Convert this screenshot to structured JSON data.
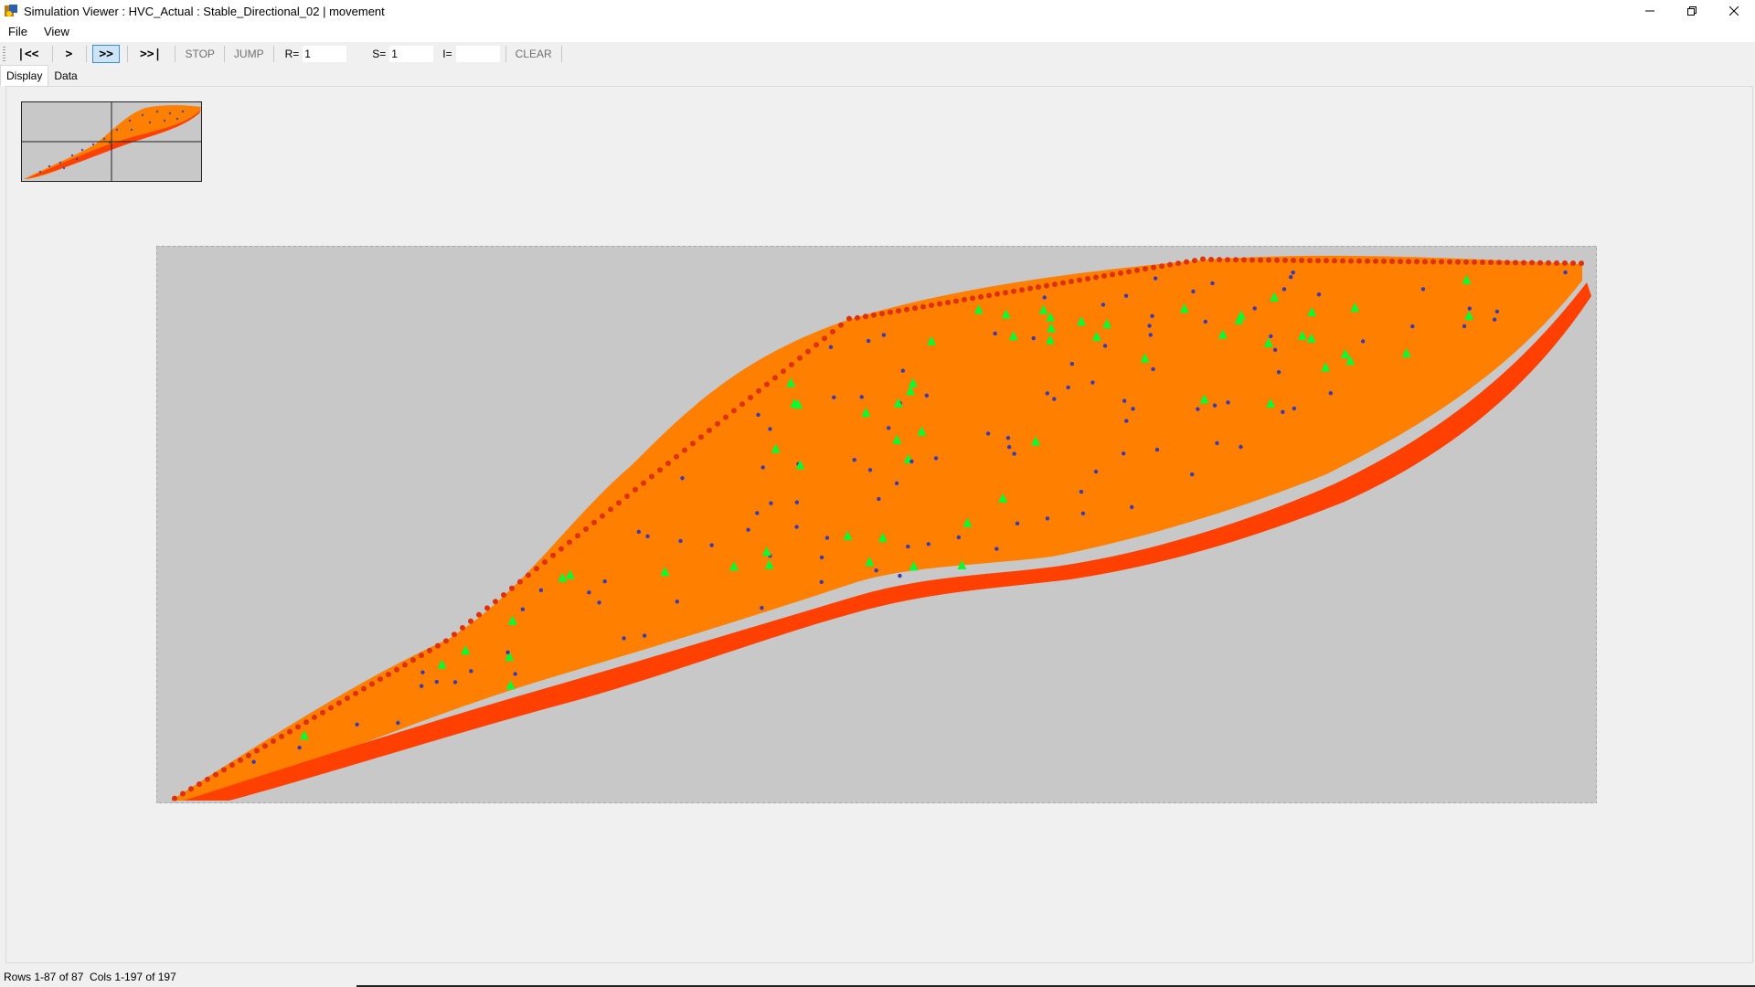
{
  "window": {
    "title": "Simulation Viewer : HVC_Actual : Stable_Directional_02 | movement",
    "controls": {
      "minimize": "–",
      "restore": "❐",
      "close": "✕"
    }
  },
  "menu": {
    "items": [
      "File",
      "View"
    ]
  },
  "toolbar": {
    "first_label": "|<<",
    "step_label": ">",
    "play_label": ">>",
    "last_label": ">>|",
    "stop_label": "STOP",
    "jump_label": "JUMP",
    "r_label": "R=",
    "r_value": "1",
    "s_label": "S=",
    "s_value": "1",
    "i_label": "I=",
    "i_value": "",
    "clear_label": "CLEAR"
  },
  "tabs": [
    {
      "label": "Display",
      "active": true
    },
    {
      "label": "Data",
      "active": false
    }
  ],
  "status": {
    "text": "Rows 1-87 of 87  Cols 1-197 of 197"
  },
  "colors": {
    "background_grid": "#c8c8c8",
    "cell_fill": "#ff7f00",
    "edge_fill": "#ff4000",
    "boundary_dot": "#e0300a",
    "agent_green": "#00ff33",
    "agent_blue": "#3a3ab0",
    "active_button": "#cce4f7"
  },
  "icons": {
    "app": "simulation-app-icon",
    "minimize": "minimize-icon",
    "restore": "restore-icon",
    "close": "close-icon"
  }
}
